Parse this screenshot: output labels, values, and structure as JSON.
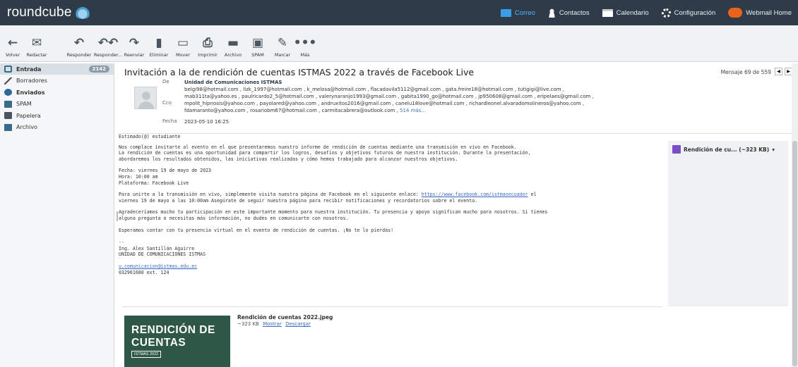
{
  "app": {
    "logo_text": "roundcube"
  },
  "topnav": [
    {
      "label": "Correo",
      "icon": "mail-icon",
      "active": true
    },
    {
      "label": "Contactos",
      "icon": "contacts-icon"
    },
    {
      "label": "Calendario",
      "icon": "calendar-icon"
    },
    {
      "label": "Configuración",
      "icon": "gear-icon"
    },
    {
      "label": "Webmail Home",
      "icon": "cpanel-icon"
    }
  ],
  "toolbar": {
    "volver": "Volver",
    "redactar": "Redactar",
    "responder": "Responder",
    "responder_todos": "Responder...",
    "reenviar": "Reenviar",
    "eliminar": "Eliminar",
    "mover": "Mover",
    "imprimir": "Imprimir",
    "archivo": "Archivo",
    "spam": "SPAM",
    "marcar": "Marcar",
    "mas": "Más"
  },
  "folders": [
    {
      "label": "Entrada",
      "count": "2142",
      "icon": "inbox-icon"
    },
    {
      "label": "Borradores",
      "icon": "pencil-icon"
    },
    {
      "label": "Enviados",
      "icon": "sent-icon"
    },
    {
      "label": "SPAM",
      "icon": "spam-icon"
    },
    {
      "label": "Papelera",
      "icon": "trash-icon"
    },
    {
      "label": "Archivo",
      "icon": "archive-icon"
    }
  ],
  "message": {
    "subject": "Invitación a la de rendición de cuentas ISTMAS 2022 a través de Facebook Live",
    "counter": "Mensaje 69 de 559",
    "from_label": "De",
    "from": "Unidad de Comunicaciones ISTMAS",
    "cc_label": "Cco",
    "cc_line1": "belgi98@hotmail.com , lizk_1997@hotmail.com , k_melosa@hotmail.com , flacadavila5112@gmail.com , gata.freire18@hotmail.com , tutigigi@live.com ,",
    "cc_line2": "mab311ta@yahoo.es , paulricardo2_5@hotmail.com , valerynaranjo1993@gmail.com , gabita1990_go@hotmail.com , jp950608@gmail.com , eripelaes@gmail.com ,",
    "cc_line3": "mpolit_hipnosis@yahoo.com , payolared@yahoo.com , andruxitos2016@gmail.com , canelu18love@hotmail.com , richardleonel.alvaradomolineros@yahoo.com ,",
    "cc_line4": "fdamaranto@yahoo.com , rosariobm67@hotmail.com , carmitacabrera@outlook.com , ",
    "cc_more": "514 más...",
    "date_label": "Fecha",
    "date": "2023-05-10 16:25"
  },
  "body": {
    "greeting": "Estimado(@) estudiante",
    "p1": "Nos complace invitarte al evento en el que presentaremos nuestro informe de rendición de cuentas mediante una transmisión en vivo en Facebook.\nLa rendición de cuentas es una oportunidad para compartir los logros, desafíos y objetivos futuros de nuestra institución. Durante la presentación,\nabordaremos los resultados obtenidos, las iniciativas realizadas y cómo hemos trabajado para alcanzar nuestros objetivos.",
    "details": "Fecha: viernes 19 de mayo de 2023\nHora: 10:00 am\nPlataforma: Facebook Live",
    "p2_a": "Para unirte a la transmisión en vivo, simplemente visita nuestra página de Facebook en el siguiente enlace: ",
    "p2_link": "https://www.facebook.com/istmasecuador",
    "p2_b": " el\nviernes 19 de mayo a las 10:00am Asegúrate de seguir nuestra página para recibir notificaciones y recordatorios sobre el evento.",
    "p3": "Agradeceríamos mucho tu participación en este importante momento para nuestra institución. Tu presencia y apoyo significan mucho para nosotros. Si tienes\nalguna pregunta o necesitas más información, no dudes en comunicarte con nosotros.",
    "p4": "Esperamos contar con tu presencia virtual en el evento de rendición de cuentas. ¡No te lo pierdas!",
    "sig": "--\nIng. Alex Santillán Aguirre\nUNIDAD DE COMUNICACIONES ISTMAS",
    "sig_email": "u.comunicacion@istmas.edu.ec",
    "sig_phone": "032961680 ext. 124"
  },
  "attachment": {
    "panel_label": "Rendición de cu... (~323 KB)",
    "name": "Rendición de cuentas 2022.jpeg",
    "size": "~323 KB",
    "show": "Mostrar",
    "download": "Descargar",
    "thumb_line1": "RENDICIÓN DE",
    "thumb_line2": "CUENTAS",
    "thumb_line3": "ISTMAS 2022"
  }
}
